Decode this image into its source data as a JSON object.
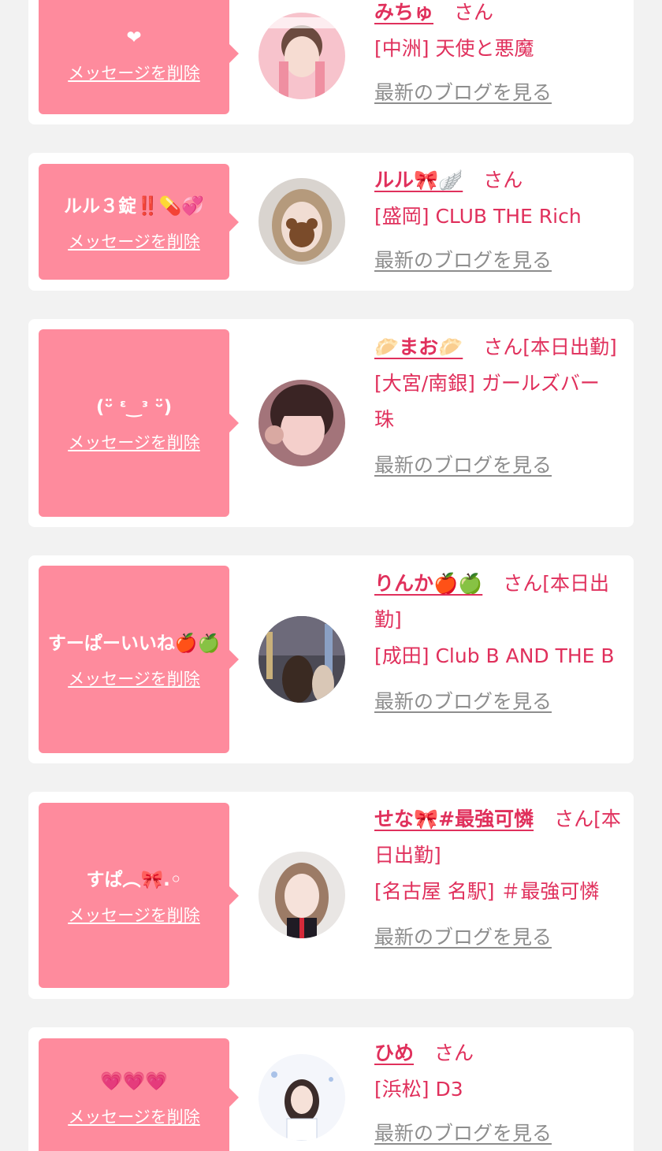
{
  "colors": {
    "accent": "#e0305c",
    "bubble": "#fe8b9d",
    "card": "#ffffff",
    "page": "#f2f2f2",
    "muted": "#8d8d8d"
  },
  "labels": {
    "delete": "メッセージを削除",
    "blog": "最新のブログを見る",
    "honorific": "さん"
  },
  "cards": [
    {
      "message": "❤",
      "name": "みちゅ",
      "suffix": "",
      "shop": "[中洲] 天使と悪魔"
    },
    {
      "message": "ルル３錠‼️💊💞",
      "name": "ルル🎀🪽",
      "suffix": "",
      "shop": "[盛岡] CLUB THE Rich"
    },
    {
      "message": "(ᵕ̈ ᵋ‿ᵌ ᵕ̈)",
      "name": "🥟まお🥟",
      "suffix": "[本日出勤]",
      "shop": "[大宮/南銀] ガールズバー 珠"
    },
    {
      "message": "すーぱーいいね🍎🍏",
      "name": "りんか🍎🍏",
      "suffix": "[本日出勤]",
      "shop": "[成田] Club B AND THE B"
    },
    {
      "message": "すぱ︵🎀.◦",
      "name": "せな🎀#最強可憐",
      "suffix": "[本日出勤]",
      "shop": "[名古屋 名駅] ＃最強可憐"
    },
    {
      "message": "💗💗💗",
      "name": "ひめ",
      "suffix": "",
      "shop": "[浜松] D3"
    }
  ]
}
